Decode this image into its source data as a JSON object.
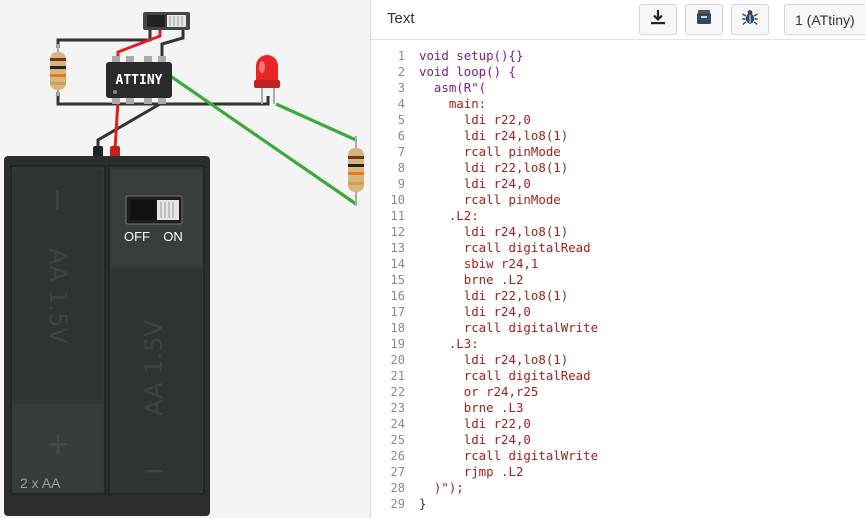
{
  "circuit": {
    "chip_label": "ATTINY",
    "battery_switch": {
      "off_label": "OFF",
      "on_label": "ON"
    },
    "battery_cells": [
      "AA 1.5V",
      "AA 1.5V"
    ],
    "battery_plus": "+",
    "battery_minus": "−",
    "battery_label": "2 x AA",
    "colors": {
      "wire_red": "#e02020",
      "wire_black": "#333333",
      "wire_green": "#3aaa3a",
      "led": "#e82626",
      "battery": "#2b2e2e"
    }
  },
  "toolbar": {
    "mode_label": "Text",
    "download_icon": "download-icon",
    "libraries_icon": "libraries-icon",
    "debugger_icon": "bug-icon",
    "device_select": "1 (ATtiny)"
  },
  "code": {
    "line_numbers": [
      "1",
      "2",
      "3",
      "4",
      "5",
      "6",
      "7",
      "8",
      "9",
      "10",
      "11",
      "12",
      "13",
      "14",
      "15",
      "16",
      "17",
      "18",
      "19",
      "20",
      "21",
      "22",
      "23",
      "24",
      "25",
      "26",
      "27",
      "28",
      "29"
    ],
    "lines": [
      "void setup(){}",
      "void loop() {",
      "  asm(R\"(",
      "    main:",
      "      ldi r22,0",
      "      ldi r24,lo8(1)",
      "      rcall pinMode",
      "      ldi r22,lo8(1)",
      "      ldi r24,0",
      "      rcall pinMode",
      "    .L2:",
      "      ldi r24,lo8(1)",
      "      rcall digitalRead",
      "      sbiw r24,1",
      "      brne .L2",
      "      ldi r22,lo8(1)",
      "      ldi r24,0",
      "      rcall digitalWrite",
      "    .L3:",
      "      ldi r24,lo8(1)",
      "      rcall digitalRead",
      "      or r24,r25",
      "      brne .L3",
      "      ldi r22,0",
      "      ldi r24,0",
      "      rcall digitalWrite",
      "      rjmp .L2",
      "  )\");",
      "}"
    ]
  }
}
